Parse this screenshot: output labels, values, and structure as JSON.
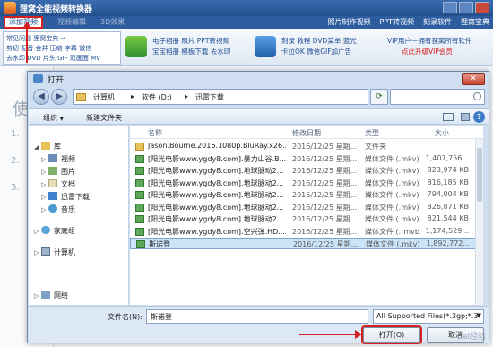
{
  "app": {
    "title": "狸窝全能视频转换器",
    "menu": {
      "add_video": "添加视频",
      "tab2": "视频编辑",
      "tab3": "3D效果"
    },
    "right_links": [
      "照片制作视频",
      "PPT转视频",
      "刻录软件",
      "狸窝宝典"
    ],
    "toolbar": {
      "links_row1": "常见问题   狸窝宝典 →",
      "links_row2": "剪切  配音  合并  压缩  字幕  微信",
      "links_row3": "去水印  DVD  片头  GIF  双画面  MV",
      "ad1": "电子相册  照片  PPT转视频",
      "ad2": "宝宝相册  模板下载  去水印",
      "ad3": "刻录  教程  DVD菜单  蓝光",
      "ad4": "卡拉OK  微信GIF加广告",
      "vip1": "VIP用户－拥有狸窝所有软件",
      "vip2": "点此升级VIP会员"
    }
  },
  "dialog": {
    "title": "打开",
    "breadcrumb": [
      "计算机",
      "软件 (D:)",
      "迅雷下载"
    ],
    "search_placeholder": "搜索 迅雷下载",
    "commands": {
      "organize": "组织",
      "new_folder": "新建文件夹"
    },
    "nav": {
      "favorites": "库",
      "items": [
        "视频",
        "图片",
        "文档",
        "迅雷下载",
        "音乐"
      ],
      "homegroup": "家庭组",
      "computer": "计算机",
      "network": "网络"
    },
    "columns": {
      "name": "名称",
      "date": "修改日期",
      "type": "类型",
      "size": "大小"
    },
    "files": [
      {
        "name": "Jason.Bourne.2016.1080p.BluRay.x26...",
        "date": "2016/12/25 星期...",
        "type": "文件夹",
        "size": ""
      },
      {
        "name": "[阳光电影www.ygdy8.com].暴力山谷.B...",
        "date": "2016/12/25 星期...",
        "type": "媒体文件 (.mkv)",
        "size": "1,407,756..."
      },
      {
        "name": "[阳光电影www.ygdy8.com].地球脉动2...",
        "date": "2016/12/25 星期...",
        "type": "媒体文件 (.mkv)",
        "size": "823,974 KB"
      },
      {
        "name": "[阳光电影www.ygdy8.com].地球脉动2...",
        "date": "2016/12/25 星期...",
        "type": "媒体文件 (.mkv)",
        "size": "816,185 KB"
      },
      {
        "name": "[阳光电影www.ygdy8.com].地球脉动2...",
        "date": "2016/12/25 星期...",
        "type": "媒体文件 (.mkv)",
        "size": "794,004 KB"
      },
      {
        "name": "[阳光电影www.ygdy8.com].地球脉动2...",
        "date": "2016/12/25 星期...",
        "type": "媒体文件 (.mkv)",
        "size": "826,871 KB"
      },
      {
        "name": "[阳光电影www.ygdy8.com].地球脉动2...",
        "date": "2016/12/25 星期...",
        "type": "媒体文件 (.mkv)",
        "size": "821,544 KB"
      },
      {
        "name": "[阳光电影www.ygdy8.com].空兴弹.HD....",
        "date": "2016/12/25 星期...",
        "type": "媒体文件 (.rmvb)",
        "size": "1,174,529..."
      },
      {
        "name": "斯诺登",
        "date": "2016/12/25 星期...",
        "type": "媒体文件 (.mkv)",
        "size": "1,892,772..."
      }
    ],
    "filename_label": "文件名(N):",
    "filename_value": "斯诺登",
    "filetype_value": "All Supported Files(*.3gp;*.3",
    "open_button": "打开(O)",
    "cancel_button": "取消"
  },
  "watermark": "Bai经验",
  "colors": {
    "accent": "#2d5d9f",
    "highlight": "#d62020",
    "selection": "#cce4f7"
  }
}
